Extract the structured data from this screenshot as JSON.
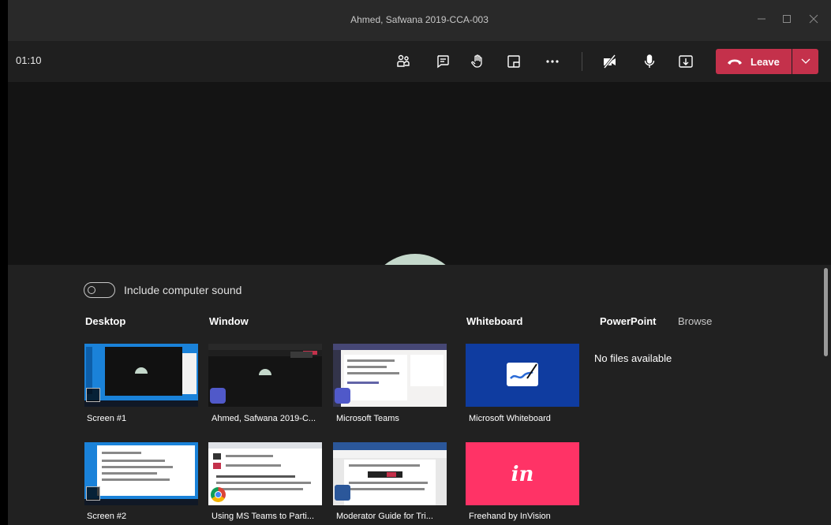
{
  "window": {
    "title": "Ahmed, Safwana 2019-CCA-003",
    "controls": [
      "minimize-icon",
      "maximize-icon",
      "close-icon"
    ]
  },
  "toolbar": {
    "timer": "01:10",
    "icons": [
      "participants-icon",
      "chat-icon",
      "raise-hand-icon",
      "fullscreen-icon",
      "more-options-icon",
      "camera-off-icon",
      "microphone-icon",
      "share-tray-icon"
    ],
    "leave_label": "Leave",
    "leave_color": "#c4314b"
  },
  "share_tray": {
    "include_sound_label": "Include computer sound",
    "include_sound_on": false,
    "sections": {
      "desktop": "Desktop",
      "window": "Window",
      "whiteboard": "Whiteboard",
      "powerpoint": "PowerPoint",
      "browse": "Browse"
    },
    "no_files": "No files available",
    "desktop_items": [
      "Screen #1",
      "Screen #2"
    ],
    "window_items": [
      "Ahmed, Safwana 2019-C...",
      "Microsoft Teams",
      "Using MS Teams to Parti...",
      "Moderator Guide for Tri..."
    ],
    "whiteboard_items": [
      "Microsoft Whiteboard",
      "Freehand by InVision"
    ],
    "colors": {
      "whiteboard_tile": "#0f3ca0",
      "invision_tile": "#ff3366",
      "screen_tile": "#1a82d9"
    }
  }
}
